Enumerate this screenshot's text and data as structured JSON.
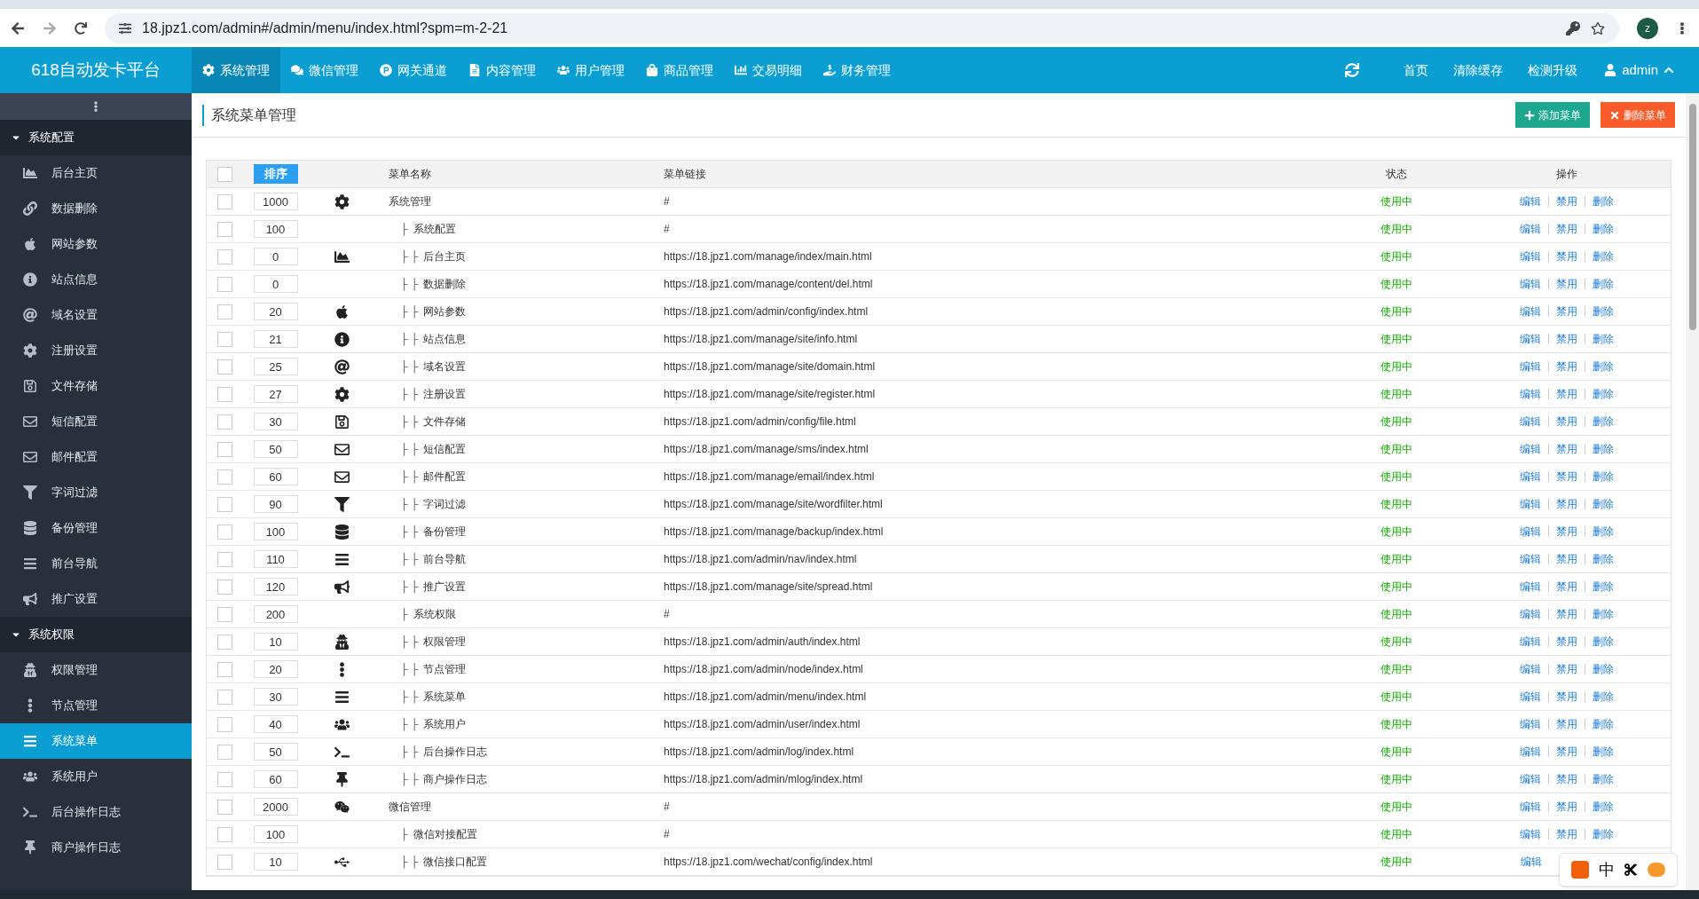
{
  "browser": {
    "url": "18.jpz1.com/admin#/admin/menu/index.html?spm=m-2-21",
    "profile": "z"
  },
  "header": {
    "brand": "618自动发卡平台",
    "nav": [
      {
        "label": "系统管理",
        "selected": true
      },
      {
        "label": "微信管理",
        "selected": false
      },
      {
        "label": "网关通道",
        "selected": false
      },
      {
        "label": "内容管理",
        "selected": false
      },
      {
        "label": "用户管理",
        "selected": false
      },
      {
        "label": "商品管理",
        "selected": false
      },
      {
        "label": "交易明细",
        "selected": false
      },
      {
        "label": "财务管理",
        "selected": false
      }
    ],
    "right": [
      "首页",
      "清除缓存",
      "检测升级"
    ],
    "user": "admin"
  },
  "sidebar": {
    "groups": [
      {
        "title": "系统配置",
        "expanded": true,
        "items": [
          {
            "label": "后台主页",
            "selected": false
          },
          {
            "label": "数据删除",
            "selected": false
          },
          {
            "label": "网站参数",
            "selected": false
          },
          {
            "label": "站点信息",
            "selected": false
          },
          {
            "label": "域名设置",
            "selected": false
          },
          {
            "label": "注册设置",
            "selected": false
          },
          {
            "label": "文件存储",
            "selected": false
          },
          {
            "label": "短信配置",
            "selected": false
          },
          {
            "label": "邮件配置",
            "selected": false
          },
          {
            "label": "字词过滤",
            "selected": false
          },
          {
            "label": "备份管理",
            "selected": false
          },
          {
            "label": "前台导航",
            "selected": false
          },
          {
            "label": "推广设置",
            "selected": false
          }
        ]
      },
      {
        "title": "系统权限",
        "expanded": true,
        "items": [
          {
            "label": "权限管理",
            "selected": false
          },
          {
            "label": "节点管理",
            "selected": false
          },
          {
            "label": "系统菜单",
            "selected": true
          },
          {
            "label": "系统用户",
            "selected": false
          },
          {
            "label": "后台操作日志",
            "selected": false
          },
          {
            "label": "商户操作日志",
            "selected": false
          }
        ]
      }
    ]
  },
  "page": {
    "title": "系统菜单管理",
    "buttons": [
      "添加菜单",
      "删除菜单"
    ]
  },
  "table": {
    "columns": [
      "排序",
      "菜单名称",
      "菜单链接",
      "状态",
      "操作"
    ],
    "all_checked": false,
    "rows": [
      {
        "sort": "1000",
        "name": "系统管理",
        "link": "#",
        "status": "使用中",
        "checked": false,
        "actions": [
          "编辑",
          "禁用",
          "删除"
        ],
        "children": [
          {
            "sort": "100",
            "prefix": "├",
            "name": "系统配置",
            "link": "#",
            "status": "使用中",
            "checked": false,
            "actions": [
              "编辑",
              "禁用",
              "删除"
            ],
            "children": [
              {
                "sort": "0",
                "prefix": "├ ├",
                "name": "后台主页",
                "link": "https://18.jpz1.com/manage/index/main.html",
                "status": "使用中",
                "checked": false,
                "actions": [
                  "编辑",
                  "禁用",
                  "删除"
                ]
              },
              {
                "sort": "0",
                "prefix": "├ ├",
                "name": "数据删除",
                "link": "https://18.jpz1.com/manage/content/del.html",
                "status": "使用中",
                "checked": false,
                "actions": [
                  "编辑",
                  "禁用",
                  "删除"
                ]
              },
              {
                "sort": "20",
                "prefix": "├ ├",
                "name": "网站参数",
                "link": "https://18.jpz1.com/admin/config/index.html",
                "status": "使用中",
                "checked": false,
                "actions": [
                  "编辑",
                  "禁用",
                  "删除"
                ]
              },
              {
                "sort": "21",
                "prefix": "├ ├",
                "name": "站点信息",
                "link": "https://18.jpz1.com/manage/site/info.html",
                "status": "使用中",
                "checked": false,
                "actions": [
                  "编辑",
                  "禁用",
                  "删除"
                ]
              },
              {
                "sort": "25",
                "prefix": "├ ├",
                "name": "域名设置",
                "link": "https://18.jpz1.com/manage/site/domain.html",
                "status": "使用中",
                "checked": false,
                "actions": [
                  "编辑",
                  "禁用",
                  "删除"
                ]
              },
              {
                "sort": "27",
                "prefix": "├ ├",
                "name": "注册设置",
                "link": "https://18.jpz1.com/manage/site/register.html",
                "status": "使用中",
                "checked": false,
                "actions": [
                  "编辑",
                  "禁用",
                  "删除"
                ]
              },
              {
                "sort": "30",
                "prefix": "├ ├",
                "name": "文件存储",
                "link": "https://18.jpz1.com/admin/config/file.html",
                "status": "使用中",
                "checked": false,
                "actions": [
                  "编辑",
                  "禁用",
                  "删除"
                ]
              },
              {
                "sort": "50",
                "prefix": "├ ├",
                "name": "短信配置",
                "link": "https://18.jpz1.com/manage/sms/index.html",
                "status": "使用中",
                "checked": false,
                "actions": [
                  "编辑",
                  "禁用",
                  "删除"
                ]
              },
              {
                "sort": "60",
                "prefix": "├ ├",
                "name": "邮件配置",
                "link": "https://18.jpz1.com/manage/email/index.html",
                "status": "使用中",
                "checked": false,
                "actions": [
                  "编辑",
                  "禁用",
                  "删除"
                ]
              },
              {
                "sort": "90",
                "prefix": "├ ├",
                "name": "字词过滤",
                "link": "https://18.jpz1.com/manage/site/wordfilter.html",
                "status": "使用中",
                "checked": false,
                "actions": [
                  "编辑",
                  "禁用",
                  "删除"
                ]
              },
              {
                "sort": "100",
                "prefix": "├ ├",
                "name": "备份管理",
                "link": "https://18.jpz1.com/manage/backup/index.html",
                "status": "使用中",
                "checked": false,
                "actions": [
                  "编辑",
                  "禁用",
                  "删除"
                ]
              },
              {
                "sort": "110",
                "prefix": "├ ├",
                "name": "前台导航",
                "link": "https://18.jpz1.com/admin/nav/index.html",
                "status": "使用中",
                "checked": false,
                "actions": [
                  "编辑",
                  "禁用",
                  "删除"
                ]
              },
              {
                "sort": "120",
                "prefix": "├ ├",
                "name": "推广设置",
                "link": "https://18.jpz1.com/manage/site/spread.html",
                "status": "使用中",
                "checked": false,
                "actions": [
                  "编辑",
                  "禁用",
                  "删除"
                ]
              }
            ]
          },
          {
            "sort": "200",
            "prefix": "├",
            "name": "系统权限",
            "link": "#",
            "status": "使用中",
            "checked": false,
            "actions": [
              "编辑",
              "禁用",
              "删除"
            ],
            "children": [
              {
                "sort": "10",
                "prefix": "├ ├",
                "name": "权限管理",
                "link": "https://18.jpz1.com/admin/auth/index.html",
                "status": "使用中",
                "checked": false,
                "actions": [
                  "编辑",
                  "禁用",
                  "删除"
                ]
              },
              {
                "sort": "20",
                "prefix": "├ ├",
                "name": "节点管理",
                "link": "https://18.jpz1.com/admin/node/index.html",
                "status": "使用中",
                "checked": false,
                "actions": [
                  "编辑",
                  "禁用",
                  "删除"
                ]
              },
              {
                "sort": "30",
                "prefix": "├ ├",
                "name": "系统菜单",
                "link": "https://18.jpz1.com/admin/menu/index.html",
                "status": "使用中",
                "checked": false,
                "actions": [
                  "编辑",
                  "禁用",
                  "删除"
                ]
              },
              {
                "sort": "40",
                "prefix": "├ ├",
                "name": "系统用户",
                "link": "https://18.jpz1.com/admin/user/index.html",
                "status": "使用中",
                "checked": false,
                "actions": [
                  "编辑",
                  "禁用",
                  "删除"
                ]
              },
              {
                "sort": "50",
                "prefix": "├ ├",
                "name": "后台操作日志",
                "link": "https://18.jpz1.com/admin/log/index.html",
                "status": "使用中",
                "checked": false,
                "actions": [
                  "编辑",
                  "禁用",
                  "删除"
                ]
              },
              {
                "sort": "60",
                "prefix": "├ ├",
                "name": "商户操作日志",
                "link": "https://18.jpz1.com/admin/mlog/index.html",
                "status": "使用中",
                "checked": false,
                "actions": [
                  "编辑",
                  "禁用",
                  "删除"
                ]
              }
            ]
          }
        ]
      },
      {
        "sort": "2000",
        "name": "微信管理",
        "link": "#",
        "status": "使用中",
        "checked": false,
        "actions": [
          "编辑",
          "禁用",
          "删除"
        ],
        "children": [
          {
            "sort": "100",
            "prefix": "├",
            "name": "微信对接配置",
            "link": "#",
            "status": "使用中",
            "checked": false,
            "actions": [
              "编辑",
              "禁用",
              "删除"
            ],
            "children": [
              {
                "sort": "10",
                "prefix": "├ ├",
                "name": "微信接口配置",
                "link": "https://18.jpz1.com/wechat/config/index.html",
                "status": "使用中",
                "checked": false,
                "actions": [
                  "编辑"
                ]
              }
            ]
          }
        ]
      }
    ]
  },
  "ime_toolbar": {
    "mode": "中"
  }
}
